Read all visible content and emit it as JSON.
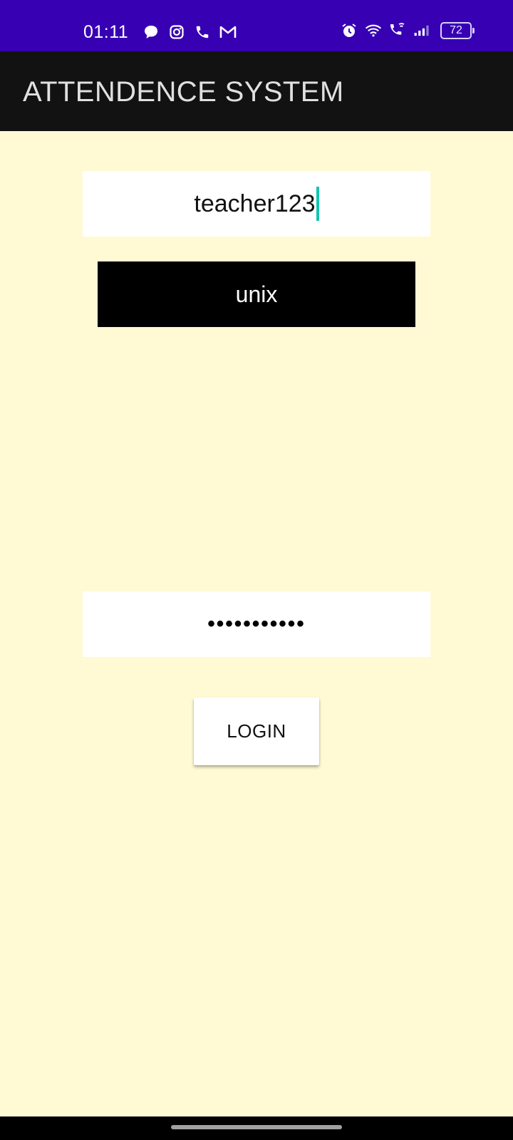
{
  "status_bar": {
    "time": "01:11",
    "battery_level": "72",
    "background_color": "#3700b3",
    "left_icons": [
      "chat-bubble-icon",
      "instagram-icon",
      "phone-icon",
      "gmail-icon"
    ],
    "right_icons": [
      "alarm-icon",
      "wifi-icon",
      "wifi-calling-icon",
      "signal-icon",
      "battery-icon"
    ]
  },
  "app_bar": {
    "title": "ATTENDENCE SYSTEM",
    "background_color": "#121212"
  },
  "form": {
    "username_value": "teacher123",
    "subject_selected": "unix",
    "password_masked": "•••••••••••",
    "login_label": "LOGIN",
    "background_color": "#fffad3",
    "cursor_color": "#14c6b0"
  }
}
